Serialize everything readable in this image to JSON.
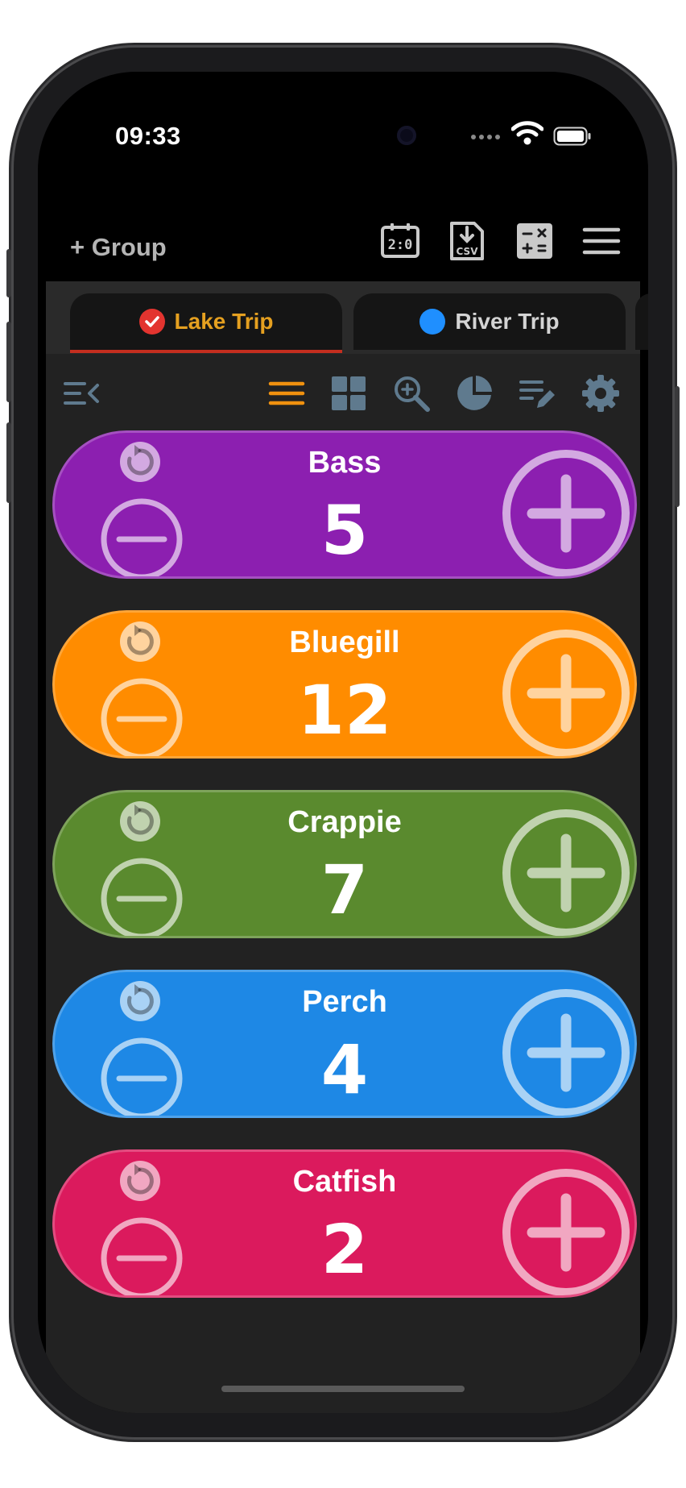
{
  "status": {
    "time": "09:33"
  },
  "topbar": {
    "add_group_label": "+ Group",
    "icons": [
      "scoreboard-icon",
      "csv-download-icon",
      "calculator-icon",
      "hamburger-menu-icon"
    ]
  },
  "tabs": [
    {
      "label": "Lake Trip",
      "color": "#e5a020",
      "badge_color": "#e3342f",
      "active": true
    },
    {
      "label": "River Trip",
      "color": "#d4d4d4",
      "badge_color": "#1f8fff",
      "active": false
    }
  ],
  "toolbar": {
    "icons": [
      "collapse-sidebar-icon",
      "list-view-icon",
      "grid-view-icon",
      "zoom-icon",
      "pie-chart-icon",
      "edit-list-icon",
      "settings-icon"
    ],
    "active_color": "#f0910f",
    "inactive_color": "#5f7a8e"
  },
  "counters": [
    {
      "name": "Bass",
      "value": "5",
      "color": "#8c1fb0"
    },
    {
      "name": "Bluegill",
      "value": "12",
      "color": "#ff8c00"
    },
    {
      "name": "Crappie",
      "value": "7",
      "color": "#5a8a2e"
    },
    {
      "name": "Perch",
      "value": "4",
      "color": "#1e88e5"
    },
    {
      "name": "Catfish",
      "value": "2",
      "color": "#db1a5d"
    }
  ]
}
